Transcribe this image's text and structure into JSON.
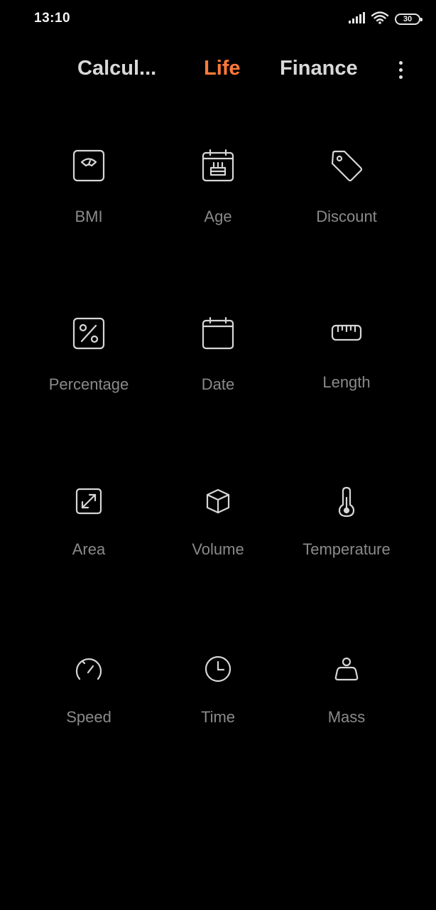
{
  "status_bar": {
    "time": "13:10",
    "battery_level": "30",
    "icons": [
      "signal-icon",
      "wifi-icon",
      "battery-icon"
    ]
  },
  "tabs": [
    {
      "label": "Calcul...",
      "active": false
    },
    {
      "label": "Life",
      "active": true
    },
    {
      "label": "Finance",
      "active": false
    }
  ],
  "colors": {
    "accent": "#ff7a38",
    "background": "#000000",
    "label": "#8a8a8a",
    "icon": "#d6d6d6"
  },
  "tools": [
    {
      "label": "BMI",
      "icon": "scale-icon"
    },
    {
      "label": "Age",
      "icon": "birthday-cake-calendar-icon"
    },
    {
      "label": "Discount",
      "icon": "price-tag-icon"
    },
    {
      "label": "Percentage",
      "icon": "percent-icon"
    },
    {
      "label": "Date",
      "icon": "calendar-icon"
    },
    {
      "label": "Length",
      "icon": "ruler-icon"
    },
    {
      "label": "Area",
      "icon": "expand-arrows-icon"
    },
    {
      "label": "Volume",
      "icon": "cube-icon"
    },
    {
      "label": "Temperature",
      "icon": "thermometer-icon"
    },
    {
      "label": "Speed",
      "icon": "speedometer-icon"
    },
    {
      "label": "Time",
      "icon": "clock-icon"
    },
    {
      "label": "Mass",
      "icon": "weight-icon"
    }
  ]
}
